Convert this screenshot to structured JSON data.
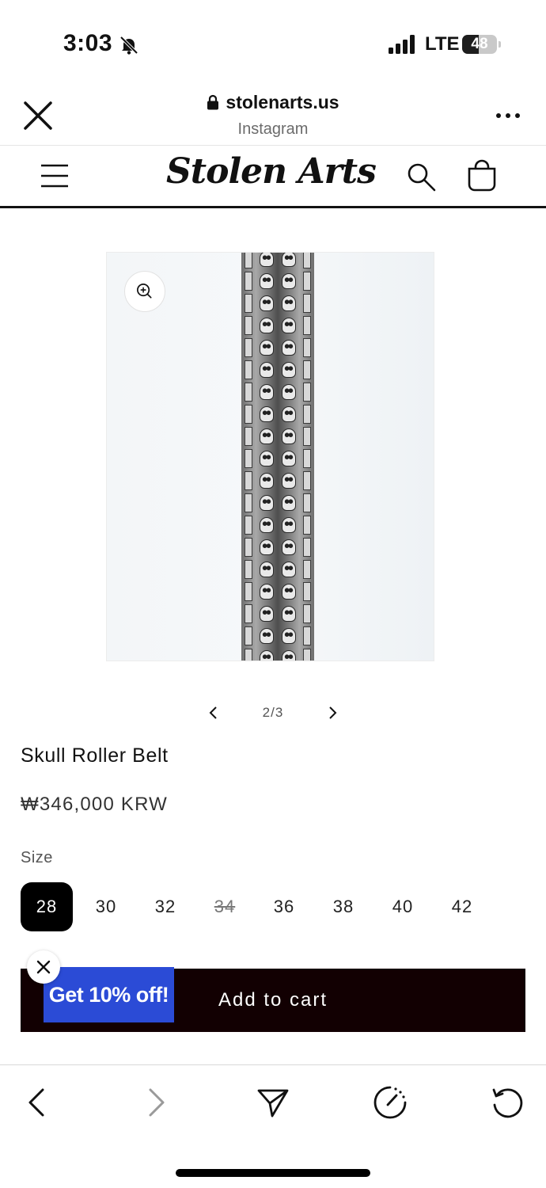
{
  "status_bar": {
    "time": "3:03",
    "network": "LTE",
    "battery_level": "48",
    "battery_fraction": 0.48
  },
  "browser": {
    "domain": "stolenarts.us",
    "source": "Instagram"
  },
  "site": {
    "logo": "Stolen Arts"
  },
  "gallery": {
    "counter": "2/3"
  },
  "product": {
    "title": "Skull Roller Belt",
    "price": "₩346,000 KRW",
    "size_label": "Size",
    "sizes": [
      {
        "label": "28",
        "state": "selected"
      },
      {
        "label": "30",
        "state": "available"
      },
      {
        "label": "32",
        "state": "available"
      },
      {
        "label": "34",
        "state": "sold-out"
      },
      {
        "label": "36",
        "state": "available"
      },
      {
        "label": "38",
        "state": "available"
      },
      {
        "label": "40",
        "state": "available"
      },
      {
        "label": "42",
        "state": "available"
      }
    ],
    "add_to_cart": "Add to cart"
  },
  "promo": {
    "label": "Get 10% off!",
    "color": "#2b4bd6"
  },
  "colors": {
    "cart_button": "#120002",
    "selected_size": "#000000"
  },
  "icons": {
    "close": "close-icon",
    "more": "more-icon",
    "menu": "hamburger-icon",
    "search": "search-icon",
    "cart": "cart-icon",
    "zoom": "zoom-in-icon",
    "back": "back-icon",
    "forward": "forward-icon",
    "share": "share-icon",
    "speed": "speed-icon",
    "reload": "reload-icon"
  }
}
